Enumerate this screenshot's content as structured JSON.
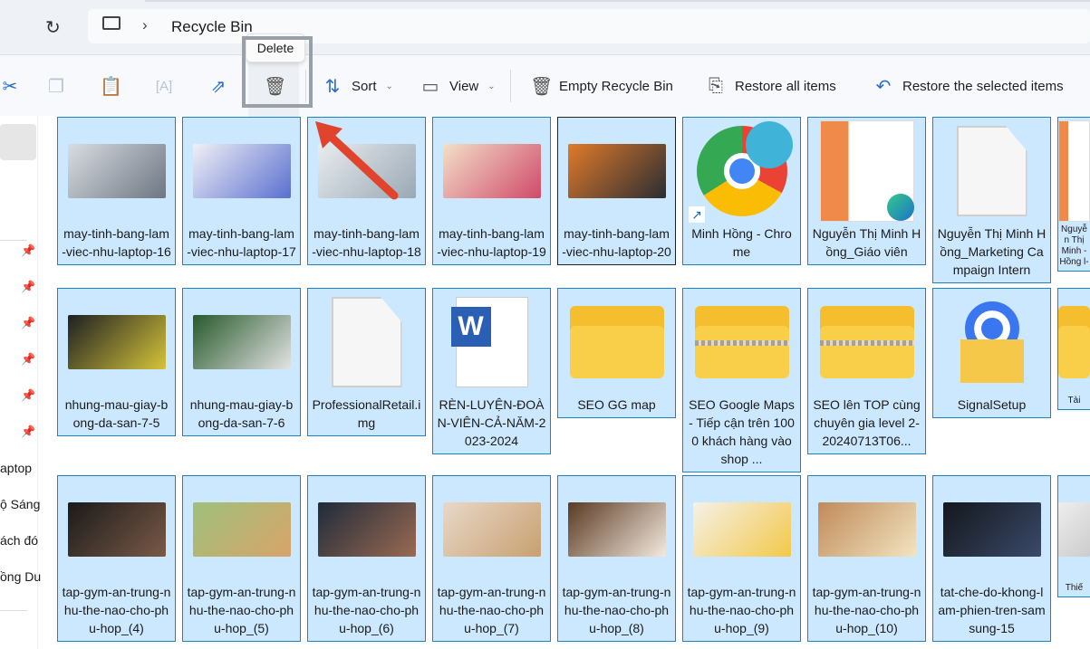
{
  "address": {
    "location_icon": "computer-icon",
    "separator": "›",
    "path": "Recycle Bin"
  },
  "tooltip": "Delete",
  "toolbar": {
    "cut": "scissors-icon",
    "copy": "copy-icon",
    "paste": "paste-icon",
    "rename": "rename-icon",
    "share": "share-icon",
    "delete": "trash-icon",
    "sort": "Sort",
    "view": "View",
    "empty": "Empty Recycle Bin",
    "restore_all": "Restore all items",
    "restore_selected": "Restore the selected items"
  },
  "sidebar": {
    "items": [
      "aptop",
      "ộ Sáng",
      "ách đó",
      "ồng Du"
    ]
  },
  "files": [
    {
      "name": "may-tinh-bang-lam-viec-nhu-laptop-16",
      "kind": "image"
    },
    {
      "name": "may-tinh-bang-lam-viec-nhu-laptop-17",
      "kind": "image"
    },
    {
      "name": "may-tinh-bang-lam-viec-nhu-laptop-18",
      "kind": "image"
    },
    {
      "name": "may-tinh-bang-lam-viec-nhu-laptop-19",
      "kind": "image"
    },
    {
      "name": "may-tinh-bang-lam-viec-nhu-laptop-20",
      "kind": "image"
    },
    {
      "name": "Minh Hồng - Chrome",
      "kind": "shortcut"
    },
    {
      "name": "Nguyễn Thị Minh Hồng_Giáo viên",
      "kind": "pdf"
    },
    {
      "name": "Nguyễn Thị Minh Hồng_Marketing Campaign Intern",
      "kind": "file"
    },
    {
      "name": "Nguyễn Thị Minh -Hồng l-",
      "kind": "doc"
    },
    {
      "name": "nhung-mau-giay-bong-da-san-7-5",
      "kind": "image"
    },
    {
      "name": "nhung-mau-giay-bong-da-san-7-6",
      "kind": "image"
    },
    {
      "name": "ProfessionalRetail.img",
      "kind": "file"
    },
    {
      "name": "RÈN-LUYỆN-ĐOÀN-VIÊN-CẢ-NĂM-2023-2024",
      "kind": "word"
    },
    {
      "name": "SEO GG map",
      "kind": "folder"
    },
    {
      "name": "SEO Google Maps - Tiếp cận trên 1000 khách hàng vào shop ...",
      "kind": "zip"
    },
    {
      "name": "SEO lên TOP cùng chuyên gia level 2-20240713T06...",
      "kind": "zip"
    },
    {
      "name": "SignalSetup",
      "kind": "installer"
    },
    {
      "name": "Tài",
      "kind": "folder"
    },
    {
      "name": "tap-gym-an-trung-nhu-the-nao-cho-phu-hop_(4)",
      "kind": "image"
    },
    {
      "name": "tap-gym-an-trung-nhu-the-nao-cho-phu-hop_(5)",
      "kind": "image"
    },
    {
      "name": "tap-gym-an-trung-nhu-the-nao-cho-phu-hop_(6)",
      "kind": "image"
    },
    {
      "name": "tap-gym-an-trung-nhu-the-nao-cho-phu-hop_(7)",
      "kind": "image"
    },
    {
      "name": "tap-gym-an-trung-nhu-the-nao-cho-phu-hop_(8)",
      "kind": "image"
    },
    {
      "name": "tap-gym-an-trung-nhu-the-nao-cho-phu-hop_(9)",
      "kind": "image"
    },
    {
      "name": "tap-gym-an-trung-nhu-the-nao-cho-phu-hop_(10)",
      "kind": "image"
    },
    {
      "name": "tat-che-do-khong-lam-phien-tren-samsung-15",
      "kind": "image"
    },
    {
      "name": "Thiế",
      "kind": "image"
    }
  ],
  "colors": {
    "selection": "#cce8ff",
    "selection_border": "#1d83c9",
    "arrow": "#e0442c"
  }
}
